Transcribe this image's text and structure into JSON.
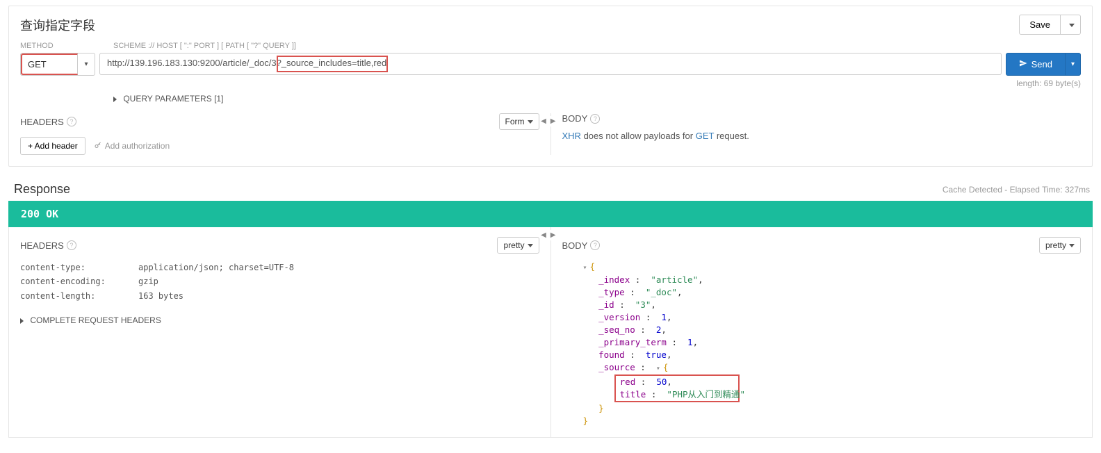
{
  "request": {
    "title": "查询指定字段",
    "save_label": "Save",
    "method_label": "METHOD",
    "url_label": "SCHEME :// HOST [ \":\" PORT ] [ PATH [ \"?\" QUERY ]]",
    "method": "GET",
    "url": "http://139.196.183.130:9200/article/_doc/3?_source_includes=title,red",
    "send_label": "Send",
    "length_text": "length: 69 byte(s)",
    "query_params_label": "QUERY PARAMETERS",
    "query_params_count": "[1]"
  },
  "req_headers": {
    "title": "HEADERS",
    "mode": "Form",
    "add_header_label": "+ Add header",
    "add_auth_label": "Add authorization"
  },
  "req_body": {
    "title": "BODY",
    "xhr": "XHR",
    "mid": " does not allow payloads for ",
    "method_ref": "GET",
    "tail": " request."
  },
  "response": {
    "title": "Response",
    "meta": "Cache Detected - Elapsed Time: 327ms",
    "status": "200 OK"
  },
  "resp_headers": {
    "title": "HEADERS",
    "mode": "pretty",
    "items": [
      {
        "k": "content-type:",
        "v": "application/json; charset=UTF-8"
      },
      {
        "k": "content-encoding:",
        "v": "gzip"
      },
      {
        "k": "content-length:",
        "v": "163 bytes"
      }
    ],
    "complete_label": "COMPLETE REQUEST HEADERS"
  },
  "resp_body": {
    "title": "BODY",
    "mode": "pretty",
    "json": {
      "_index": "article",
      "_type": "_doc",
      "_id": "3",
      "_version": 1,
      "_seq_no": 2,
      "_primary_term": 1,
      "found": true,
      "_source": {
        "red": 50,
        "title": "PHP从入门到精通"
      }
    }
  }
}
